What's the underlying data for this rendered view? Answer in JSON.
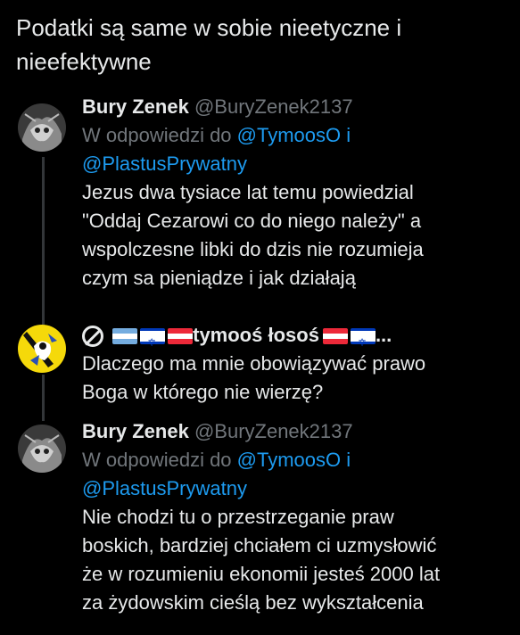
{
  "top": {
    "text": "Podatki są same w sobie nieetyczne i nieefektywne"
  },
  "posts": [
    {
      "name": "Bury Zenek",
      "handle": "@BuryZenek2137",
      "reply_prefix": "W odpowiedzi do",
      "mention1": "@TymoosO",
      "mention_conj": "i",
      "mention2": "@PlastusPrywatny",
      "lines": [
        "Jezus dwa tysiace lat temu powiedzial",
        "\"Oddaj Cezarowi co do niego należy\" a",
        "wspolczesne libki do dzis nie rozumieja",
        "czym sa pieniądze i jak działają"
      ]
    },
    {
      "name": "tymooś łosoś",
      "ellipsis": "...",
      "lines": [
        "Dlaczego ma mnie obowiązywać prawo",
        "Boga w którego nie wierzę?"
      ]
    },
    {
      "name": "Bury Zenek",
      "handle": "@BuryZenek2137",
      "reply_prefix": "W odpowiedzi do",
      "mention1": "@TymoosO",
      "mention_conj": "i",
      "mention2": "@PlastusPrywatny",
      "lines": [
        "Nie chodzi tu o przestrzeganie praw",
        "boskich, bardziej chciałem ci uzmysłowić",
        "że w rozumieniu ekonomii jesteś 2000 lat",
        "za żydowskim cieślą bez wykształcenia"
      ]
    }
  ],
  "colors": {
    "background": "#000000",
    "text": "#e7e9ea",
    "muted": "#71767b",
    "link": "#1d9bf0"
  }
}
